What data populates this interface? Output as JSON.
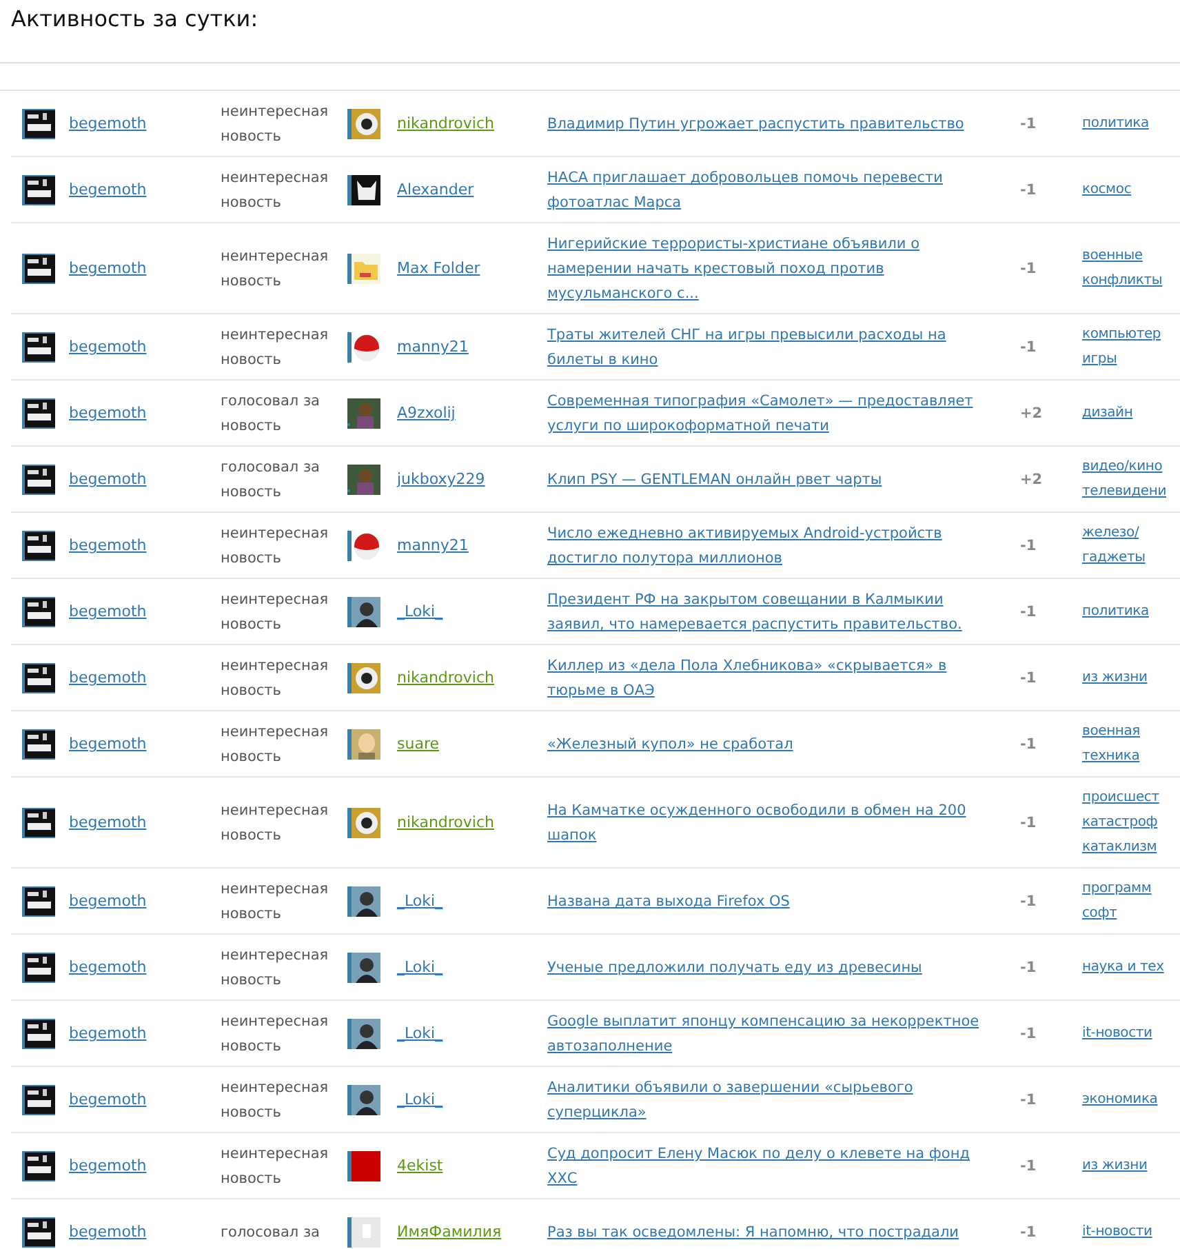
{
  "title": "Активность за сутки:",
  "rows": [
    {
      "actor": {
        "name": "begemoth",
        "kind": "stamp",
        "color": "#2f78b3"
      },
      "action": "неинтересная новость",
      "target": {
        "name": "nikandrovich",
        "kind": "ball",
        "color": "#5b9a12"
      },
      "news": "Владимир Путин угрожает распустить правительство",
      "score": "-1",
      "category": "политика"
    },
    {
      "actor": {
        "name": "begemoth",
        "kind": "stamp",
        "color": "#2f78b3"
      },
      "action": "неинтересная новость",
      "target": {
        "name": "Alexander",
        "kind": "cat",
        "color": "#2f78b3"
      },
      "news": "НАСА приглашает добровольцев помочь перевести фотоатлас Марса",
      "score": "-1",
      "category": "космос"
    },
    {
      "actor": {
        "name": "begemoth",
        "kind": "stamp",
        "color": "#2f78b3"
      },
      "action": "неинтересная новость",
      "target": {
        "name": "Max Folder",
        "kind": "folder",
        "color": "#2f78b3"
      },
      "news": "Нигерийские террористы-христиане объявили о намерении начать крестовый поход против мусульманского с...",
      "score": "-1",
      "category": "военные конфликты"
    },
    {
      "actor": {
        "name": "begemoth",
        "kind": "stamp",
        "color": "#2f78b3"
      },
      "action": "неинтересная новость",
      "target": {
        "name": "manny21",
        "kind": "hat",
        "color": "#2f78b3"
      },
      "news": "Траты жителей СНГ на игры превысили расходы на билеты в кино",
      "score": "-1",
      "category": "компьютер игры"
    },
    {
      "actor": {
        "name": "begemoth",
        "kind": "stamp",
        "color": "#2f78b3"
      },
      "action": "голосовал за новость",
      "target": {
        "name": "A9zxolij",
        "kind": "figure",
        "color": "#2f78b3"
      },
      "news": "Современная типография «Самолет» — предоставляет услуги по широкоформатной печати",
      "score": "+2",
      "category": "дизайн"
    },
    {
      "actor": {
        "name": "begemoth",
        "kind": "stamp",
        "color": "#2f78b3"
      },
      "action": "голосовал за новость",
      "target": {
        "name": "jukboxy229",
        "kind": "figure",
        "color": "#2f78b3"
      },
      "news": "Клип PSY — GENTLEMAN онлайн рвет чарты",
      "score": "+2",
      "category": "видео/кино телевидени"
    },
    {
      "actor": {
        "name": "begemoth",
        "kind": "stamp",
        "color": "#2f78b3"
      },
      "action": "неинтересная новость",
      "target": {
        "name": "manny21",
        "kind": "hat",
        "color": "#2f78b3"
      },
      "news": "Число ежедневно активируемых Android-устройств достигло полутора миллионов",
      "score": "-1",
      "category": "железо/ гаджеты"
    },
    {
      "actor": {
        "name": "begemoth",
        "kind": "stamp",
        "color": "#2f78b3"
      },
      "action": "неинтересная новость",
      "target": {
        "name": "_Loki_",
        "kind": "portrait",
        "color": "#2f78b3"
      },
      "news": "Президент РФ на закрытом совещании в Калмыкии заявил, что намеревается распустить правительство.",
      "score": "-1",
      "category": "политика"
    },
    {
      "actor": {
        "name": "begemoth",
        "kind": "stamp",
        "color": "#2f78b3"
      },
      "action": "неинтересная новость",
      "target": {
        "name": "nikandrovich",
        "kind": "ball",
        "color": "#5b9a12"
      },
      "news": "Киллер из «дела Пола Хлебникова» «скрывается» в тюрьме в ОАЭ",
      "score": "-1",
      "category": "из жизни"
    },
    {
      "actor": {
        "name": "begemoth",
        "kind": "stamp",
        "color": "#2f78b3"
      },
      "action": "неинтересная новость",
      "target": {
        "name": "suare",
        "kind": "face",
        "color": "#5b9a12"
      },
      "news": "«Железный купол» не сработал",
      "score": "-1",
      "category": "военная техника"
    },
    {
      "actor": {
        "name": "begemoth",
        "kind": "stamp",
        "color": "#2f78b3"
      },
      "action": "неинтересная новость",
      "target": {
        "name": "nikandrovich",
        "kind": "ball",
        "color": "#5b9a12"
      },
      "news": "На Камчатке осужденного освободили в обмен на 200 шапок",
      "score": "-1",
      "category": "происшест катастроф катаклизм"
    },
    {
      "actor": {
        "name": "begemoth",
        "kind": "stamp",
        "color": "#2f78b3"
      },
      "action": "неинтересная новость",
      "target": {
        "name": "_Loki_",
        "kind": "portrait",
        "color": "#2f78b3"
      },
      "news": "Названа дата выхода Firefox OS",
      "score": "-1",
      "category": "программ софт"
    },
    {
      "actor": {
        "name": "begemoth",
        "kind": "stamp",
        "color": "#2f78b3"
      },
      "action": "неинтересная новость",
      "target": {
        "name": "_Loki_",
        "kind": "portrait",
        "color": "#2f78b3"
      },
      "news": "Ученые предложили получать еду из древесины",
      "score": "-1",
      "category": "наука и тех"
    },
    {
      "actor": {
        "name": "begemoth",
        "kind": "stamp",
        "color": "#2f78b3"
      },
      "action": "неинтересная новость",
      "target": {
        "name": "_Loki_",
        "kind": "portrait",
        "color": "#2f78b3"
      },
      "news": "Google выплатит японцу компенсацию за некорректное автозаполнение",
      "score": "-1",
      "category": "it-новости"
    },
    {
      "actor": {
        "name": "begemoth",
        "kind": "stamp",
        "color": "#2f78b3"
      },
      "action": "неинтересная новость",
      "target": {
        "name": "_Loki_",
        "kind": "portrait",
        "color": "#2f78b3"
      },
      "news": "Аналитики объявили о завершении «сырьевого суперцикла»",
      "score": "-1",
      "category": "экономика"
    },
    {
      "actor": {
        "name": "begemoth",
        "kind": "stamp",
        "color": "#2f78b3"
      },
      "action": "неинтересная новость",
      "target": {
        "name": "4ekist",
        "kind": "red",
        "color": "#5b9a12"
      },
      "news": "Суд допросит Елену Масюк по делу о клевете на фонд ХХС",
      "score": "-1",
      "category": "из жизни"
    },
    {
      "actor": {
        "name": "begemoth",
        "kind": "stamp",
        "color": "#2f78b3"
      },
      "action": "голосовал за",
      "target": {
        "name": "ИмяФамилия",
        "kind": "blank",
        "color": "#5b9a12"
      },
      "news": "Раз вы так осведомлены: Я напомню, что пострадали",
      "score": "-1",
      "category": "it-новости"
    }
  ]
}
